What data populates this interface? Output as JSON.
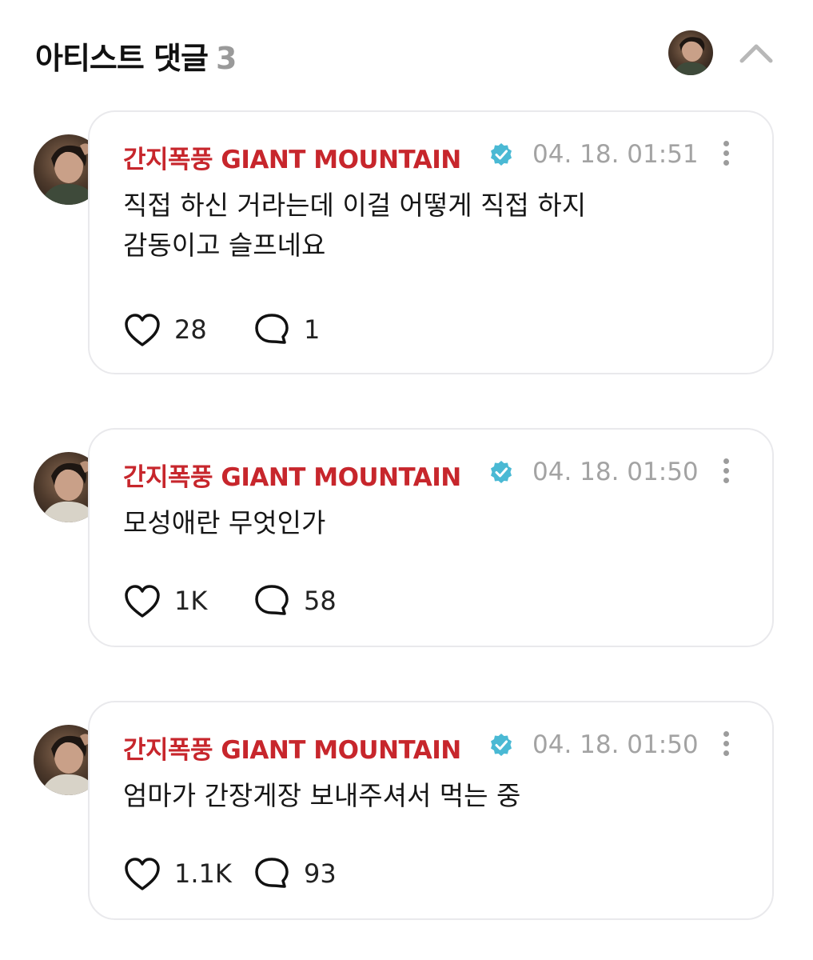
{
  "header": {
    "title": "아티스트 댓글",
    "count": "3"
  },
  "colors": {
    "author": "#c7262c",
    "verified_badge": "#4ab9d4",
    "timestamp": "#a3a3a3",
    "bubble_border": "#e9e9ec"
  },
  "icons": {
    "collapse": "chevron-up-icon",
    "verified": "verified-badge-icon",
    "more": "more-vertical-icon",
    "like": "heart-icon",
    "reply": "speech-bubble-icon"
  },
  "comments": [
    {
      "author": "간지폭풍 GIANT MOUNTAIN",
      "timestamp": "04. 18. 01:51",
      "text": "직접 하신 거라는데 이걸 어떻게 직접 하지\n감동이고 슬프네요",
      "likes": "28",
      "replies": "1"
    },
    {
      "author": "간지폭풍 GIANT MOUNTAIN",
      "timestamp": "04. 18. 01:50",
      "text": "모성애란 무엇인가",
      "likes": "1K",
      "replies": "58"
    },
    {
      "author": "간지폭풍 GIANT MOUNTAIN",
      "timestamp": "04. 18. 01:50",
      "text": "엄마가 간장게장 보내주셔서 먹는 중",
      "likes": "1.1K",
      "replies": "93"
    }
  ]
}
